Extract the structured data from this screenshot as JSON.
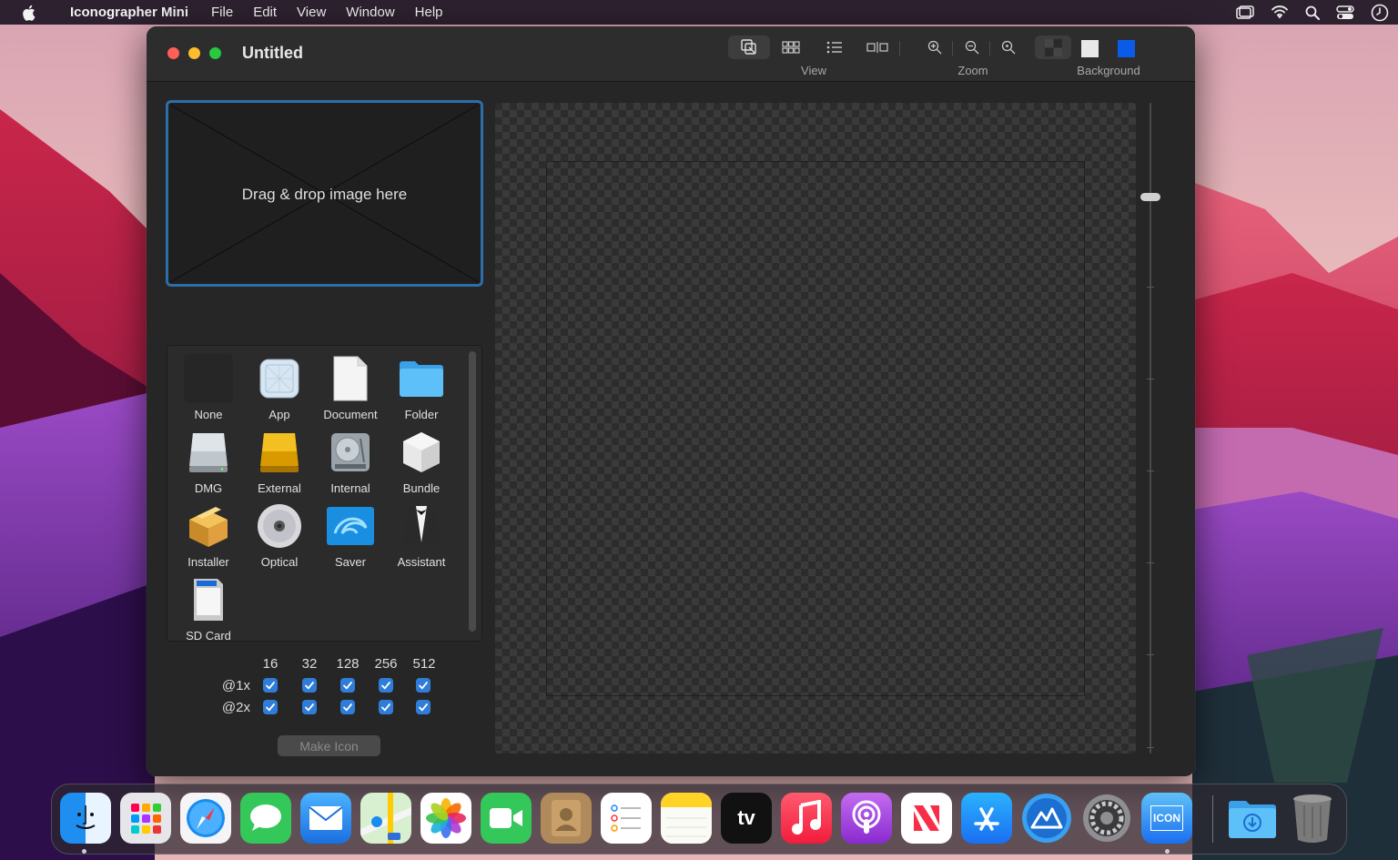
{
  "menubar": {
    "app_name": "Iconographer Mini",
    "menus": [
      "File",
      "Edit",
      "View",
      "Window",
      "Help"
    ],
    "status_icons": [
      "screen-mirroring-icon",
      "wifi-icon",
      "spotlight-search-icon",
      "control-center-icon",
      "clock-icon"
    ]
  },
  "window": {
    "title": "Untitled",
    "toolbar": {
      "view_label": "View",
      "zoom_label": "Zoom",
      "background_label": "Background",
      "view_buttons": [
        "single-preview-icon",
        "grid-view-icon",
        "list-view-icon",
        "compare-view-icon"
      ],
      "zoom_buttons": [
        "zoom-in-icon",
        "zoom-out-icon",
        "zoom-actual-icon"
      ],
      "background_options": [
        {
          "name": "checkerboard",
          "color": "#3a3a3a"
        },
        {
          "name": "light",
          "color": "#e8e8e8"
        },
        {
          "name": "blue",
          "color": "#0a5ce8"
        }
      ]
    }
  },
  "dropzone": {
    "label": "Drag & drop image here"
  },
  "icon_templates": [
    "None",
    "App",
    "Document",
    "Folder",
    "DMG",
    "External",
    "Internal",
    "Bundle",
    "Installer",
    "Optical",
    "Saver",
    "Assistant",
    "SD Card"
  ],
  "sizes": {
    "columns": [
      "16",
      "32",
      "128",
      "256",
      "512"
    ],
    "rows": [
      "@1x",
      "@2x"
    ],
    "checked": [
      [
        true,
        true,
        true,
        true,
        true
      ],
      [
        true,
        true,
        true,
        true,
        true
      ]
    ]
  },
  "make_icon_label": "Make Icon",
  "zoom_level": 0.2,
  "dock": {
    "apps": [
      "finder",
      "launchpad",
      "safari",
      "messages",
      "mail",
      "maps",
      "photos",
      "facetime",
      "contacts",
      "reminders",
      "notes",
      "tv",
      "music",
      "podcasts",
      "news",
      "app-store",
      "altimeter",
      "system-preferences",
      "iconographer"
    ],
    "tv_label": "tv",
    "iconographer_label": "ICON",
    "running": [
      "finder",
      "iconographer"
    ],
    "stacks": [
      "downloads",
      "trash"
    ]
  }
}
